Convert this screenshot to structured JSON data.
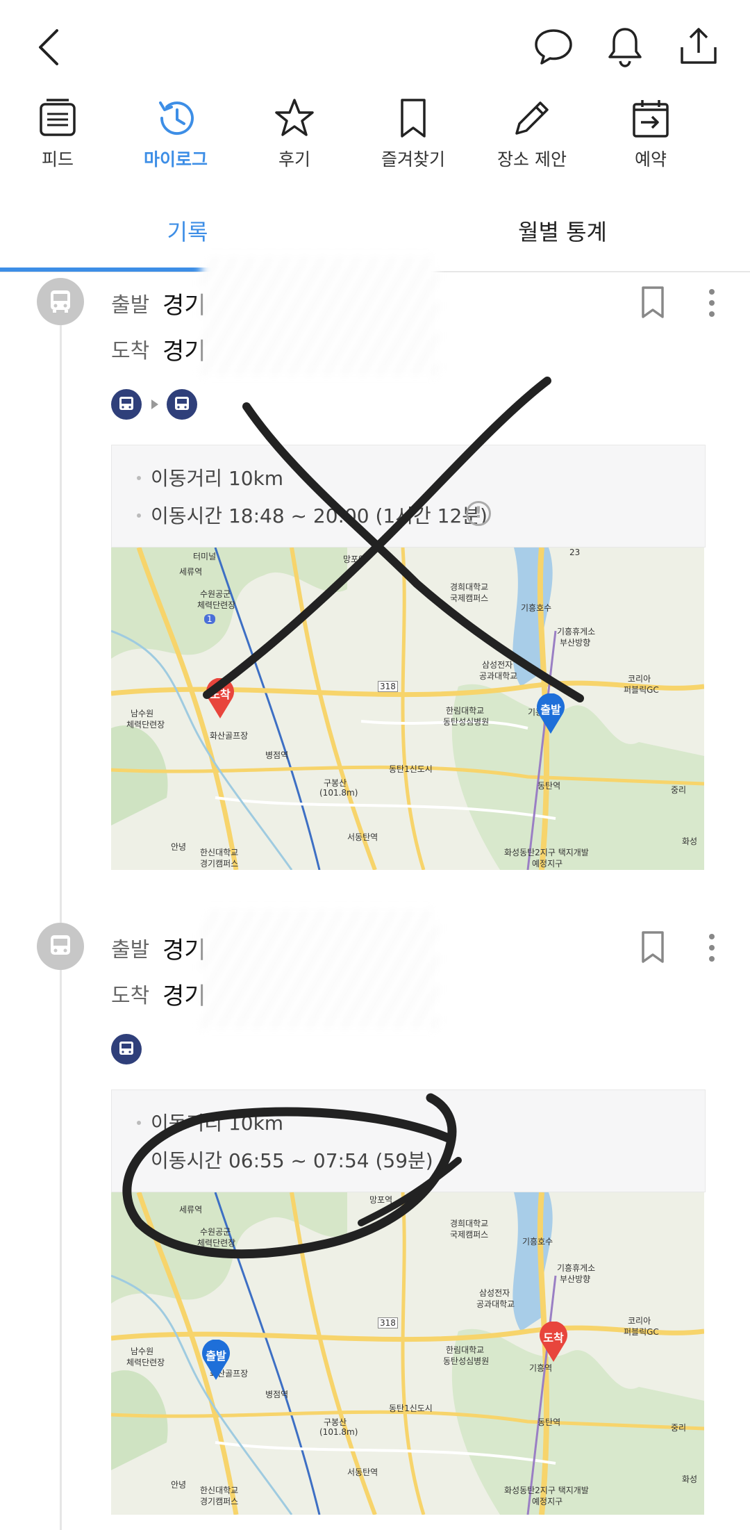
{
  "header": {
    "icons": [
      "back-icon",
      "chat-icon",
      "bell-icon",
      "share-icon"
    ]
  },
  "icon_tabs": [
    {
      "label": "피드",
      "icon": "feed-icon"
    },
    {
      "label": "마이로그",
      "icon": "history-icon",
      "active": true
    },
    {
      "label": "후기",
      "icon": "star-icon"
    },
    {
      "label": "즐겨찾기",
      "icon": "bookmark-icon"
    },
    {
      "label": "장소 제안",
      "icon": "pencil-icon"
    },
    {
      "label": "예약",
      "icon": "calendar-icon"
    }
  ],
  "segment_tabs": {
    "records": "기록",
    "monthly": "월별 통계"
  },
  "entries": [
    {
      "depart_label": "출발",
      "depart_addr": "경기",
      "arrive_label": "도착",
      "arrive_addr": "경기",
      "distance": "이동거리 10km",
      "duration": "이동시간 18:48 ~ 20:00 (1시간 12분)",
      "warning": "!",
      "pin_start": "출발",
      "pin_end": "도착"
    },
    {
      "depart_label": "출발",
      "depart_addr": "경기",
      "arrive_label": "도착",
      "arrive_addr": "경기",
      "distance": "이동거리 10km",
      "duration": "이동시간 06:55 ~ 07:54 (59분)",
      "pin_start": "출발",
      "pin_end": "도착"
    }
  ],
  "map_labels": {
    "l1": "터미널",
    "l2": "세류역",
    "l3": "수원공군",
    "l4": "체력단련장",
    "l5": "망포역",
    "l6": "경희대학교",
    "l7": "국제캠퍼스",
    "l8": "기흥호수",
    "l9": "기흥휴게소",
    "l10": "부산방향",
    "l11": "삼성전자",
    "l12": "공과대학교",
    "l13": "코리아",
    "l14": "퍼블릭GC",
    "l15": "318",
    "l16": "한림대학교",
    "l17": "동탄성심병원",
    "l18": "기흥역",
    "l19": "남수원",
    "l20": "체력단련장",
    "l21": "화산골프장",
    "l22": "병점역",
    "l23": "구봉산",
    "l24": "(101.8m)",
    "l25": "동탄1신도시",
    "l26": "동탄역",
    "l27": "서동탄역",
    "l28": "한신대학교",
    "l29": "경기캠퍼스",
    "l30": "화성동탄2지구 택지개발",
    "l31": "예정지구",
    "l32": "안녕",
    "l33": "중리",
    "l34": "화성",
    "l35": "23",
    "l36": "1"
  }
}
